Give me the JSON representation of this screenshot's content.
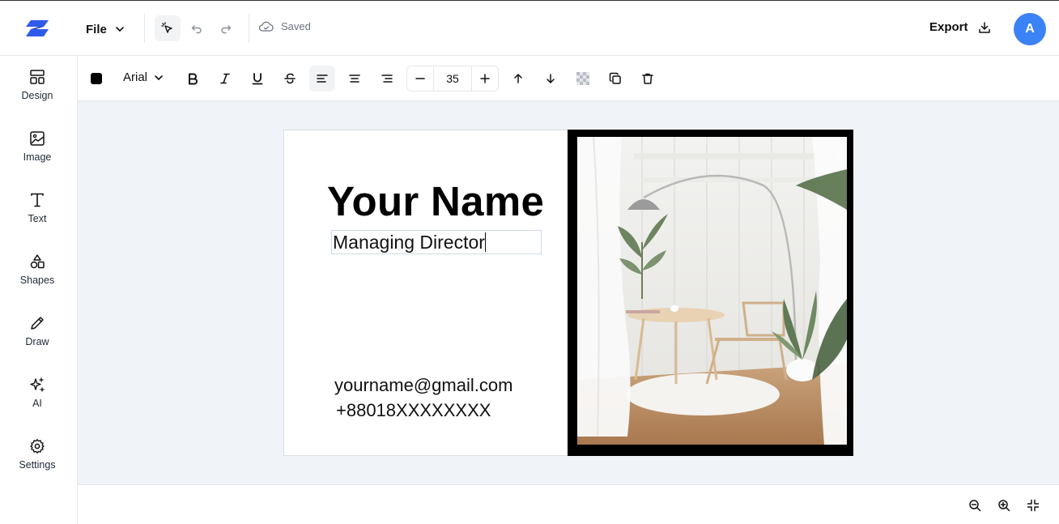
{
  "header": {
    "file_label": "File",
    "saved_label": "Saved",
    "export_label": "Export",
    "avatar_initial": "A",
    "brand_color": "#3b5bdb",
    "avatar_color": "#3b82f6"
  },
  "sidebar": {
    "items": [
      {
        "label": "Design",
        "icon": "layout-icon"
      },
      {
        "label": "Image",
        "icon": "image-icon"
      },
      {
        "label": "Text",
        "icon": "text-icon"
      },
      {
        "label": "Shapes",
        "icon": "shapes-icon"
      },
      {
        "label": "Draw",
        "icon": "pencil-icon"
      },
      {
        "label": "AI",
        "icon": "sparkles-icon"
      },
      {
        "label": "Settings",
        "icon": "gear-icon"
      }
    ]
  },
  "text_toolbar": {
    "color": "#000000",
    "font_family": "Arial",
    "font_size": "35",
    "active_align": "left"
  },
  "card": {
    "name": "Your Name",
    "job_title": "Managing Director",
    "email": "yourname@gmail.com",
    "phone": "+88018XXXXXXXX"
  }
}
